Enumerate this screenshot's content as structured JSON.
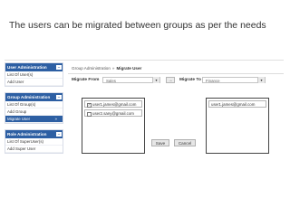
{
  "slide": {
    "title": "The users can be migrated between groups as per the needs"
  },
  "sidebar": {
    "panels": [
      {
        "title": "User Administration",
        "toggle": "–",
        "items": [
          {
            "label": "List Of User(s)"
          },
          {
            "label": "Add User"
          }
        ]
      },
      {
        "title": "Group Administration",
        "toggle": "–",
        "items": [
          {
            "label": "List Of Group(s)"
          },
          {
            "label": "Add Group"
          },
          {
            "label": "Migrate User",
            "arrow": "»"
          }
        ]
      },
      {
        "title": "Role Administration",
        "toggle": "–",
        "items": [
          {
            "label": "List Of SuperUser(s)"
          },
          {
            "label": "Add Super User"
          }
        ]
      }
    ]
  },
  "breadcrumb": {
    "parent": "Group Administration",
    "separator": "»",
    "current": "Migrate User"
  },
  "migrate": {
    "from_label": "Migrate From",
    "from_value": "Sales",
    "to_label": "Migrate To",
    "to_value": "Finance",
    "drop_icon": "▾",
    "source_users": [
      {
        "email": "user1.james@gmail.com",
        "checked": true,
        "check_glyph": "✓"
      },
      {
        "email": "user2.sany@gmail.com",
        "checked": false,
        "check_glyph": ""
      }
    ],
    "target_users": [
      {
        "email": "user1.james@gmail.com"
      }
    ],
    "move_glyph": "→"
  },
  "buttons": {
    "save": "Save",
    "cancel": "Cancel"
  },
  "colors": {
    "header": "#2d5fa3",
    "accent_active": "#2d5fa3"
  }
}
